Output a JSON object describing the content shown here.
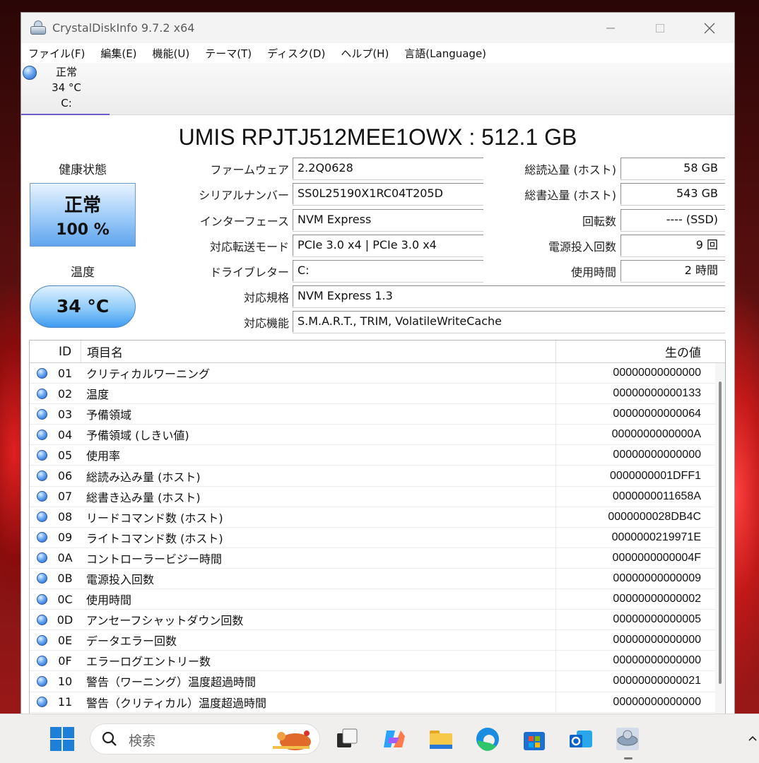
{
  "window": {
    "title": "CrystalDiskInfo 9.7.2 x64"
  },
  "menu": [
    "ファイル(F)",
    "編集(E)",
    "機能(U)",
    "テーマ(T)",
    "ディスク(D)",
    "ヘルプ(H)",
    "言語(Language)"
  ],
  "disk_tab": {
    "status": "正常",
    "temp": "34 °C",
    "drive": "C:"
  },
  "model": "UMIS RPJTJ512MEE1OWX : 512.1 GB",
  "health": {
    "label": "健康状態",
    "status": "正常",
    "percent": "100 %"
  },
  "temperature": {
    "label": "温度",
    "value": "34 °C"
  },
  "info_left": [
    {
      "label": "ファームウェア",
      "value": "2.2Q0628"
    },
    {
      "label": "シリアルナンバー",
      "value": "SS0L25190X1RC04T205D"
    },
    {
      "label": "インターフェース",
      "value": "NVM Express"
    },
    {
      "label": "対応転送モード",
      "value": "PCIe 3.0 x4 | PCIe 3.0 x4"
    },
    {
      "label": "ドライブレター",
      "value": "C:"
    }
  ],
  "info_right": [
    {
      "label": "総読込量 (ホスト)",
      "value": "58 GB"
    },
    {
      "label": "総書込量 (ホスト)",
      "value": "543 GB"
    },
    {
      "label": "回転数",
      "value": "---- (SSD)"
    },
    {
      "label": "電源投入回数",
      "value": "9 回"
    },
    {
      "label": "使用時間",
      "value": "2 時間"
    }
  ],
  "standard": {
    "label": "対応規格",
    "value": "NVM Express 1.3"
  },
  "features": {
    "label": "対応機能",
    "value": "S.M.A.R.T., TRIM, VolatileWriteCache"
  },
  "smart_headers": {
    "id": "ID",
    "name": "項目名",
    "raw": "生の値"
  },
  "smart_rows": [
    {
      "id": "01",
      "name": "クリティカルワーニング",
      "raw": "00000000000000"
    },
    {
      "id": "02",
      "name": "温度",
      "raw": "00000000000133"
    },
    {
      "id": "03",
      "name": "予備領域",
      "raw": "00000000000064"
    },
    {
      "id": "04",
      "name": "予備領域 (しきい値)",
      "raw": "0000000000000A"
    },
    {
      "id": "05",
      "name": "使用率",
      "raw": "00000000000000"
    },
    {
      "id": "06",
      "name": "総読み込み量 (ホスト)",
      "raw": "0000000001DFF1"
    },
    {
      "id": "07",
      "name": "総書き込み量 (ホスト)",
      "raw": "0000000011658A"
    },
    {
      "id": "08",
      "name": "リードコマンド数 (ホスト)",
      "raw": "0000000028DB4C"
    },
    {
      "id": "09",
      "name": "ライトコマンド数 (ホスト)",
      "raw": "0000000219971E"
    },
    {
      "id": "0A",
      "name": "コントローラービジー時間",
      "raw": "0000000000004F"
    },
    {
      "id": "0B",
      "name": "電源投入回数",
      "raw": "00000000000009"
    },
    {
      "id": "0C",
      "name": "使用時間",
      "raw": "00000000000002"
    },
    {
      "id": "0D",
      "name": "アンセーフシャットダウン回数",
      "raw": "00000000000005"
    },
    {
      "id": "0E",
      "name": "データエラー回数",
      "raw": "00000000000000"
    },
    {
      "id": "0F",
      "name": "エラーログエントリー数",
      "raw": "00000000000000"
    },
    {
      "id": "10",
      "name": "警告（ワーニング）温度超過時間",
      "raw": "00000000000021"
    },
    {
      "id": "11",
      "name": "警告（クリティカル）温度超過時間",
      "raw": "00000000000000"
    }
  ],
  "taskbar": {
    "search_placeholder": "検索"
  },
  "colors": {
    "accent": "#6d5bd0",
    "health_blue": "#5fa4ee",
    "status_dot": "#1d5cc9"
  }
}
